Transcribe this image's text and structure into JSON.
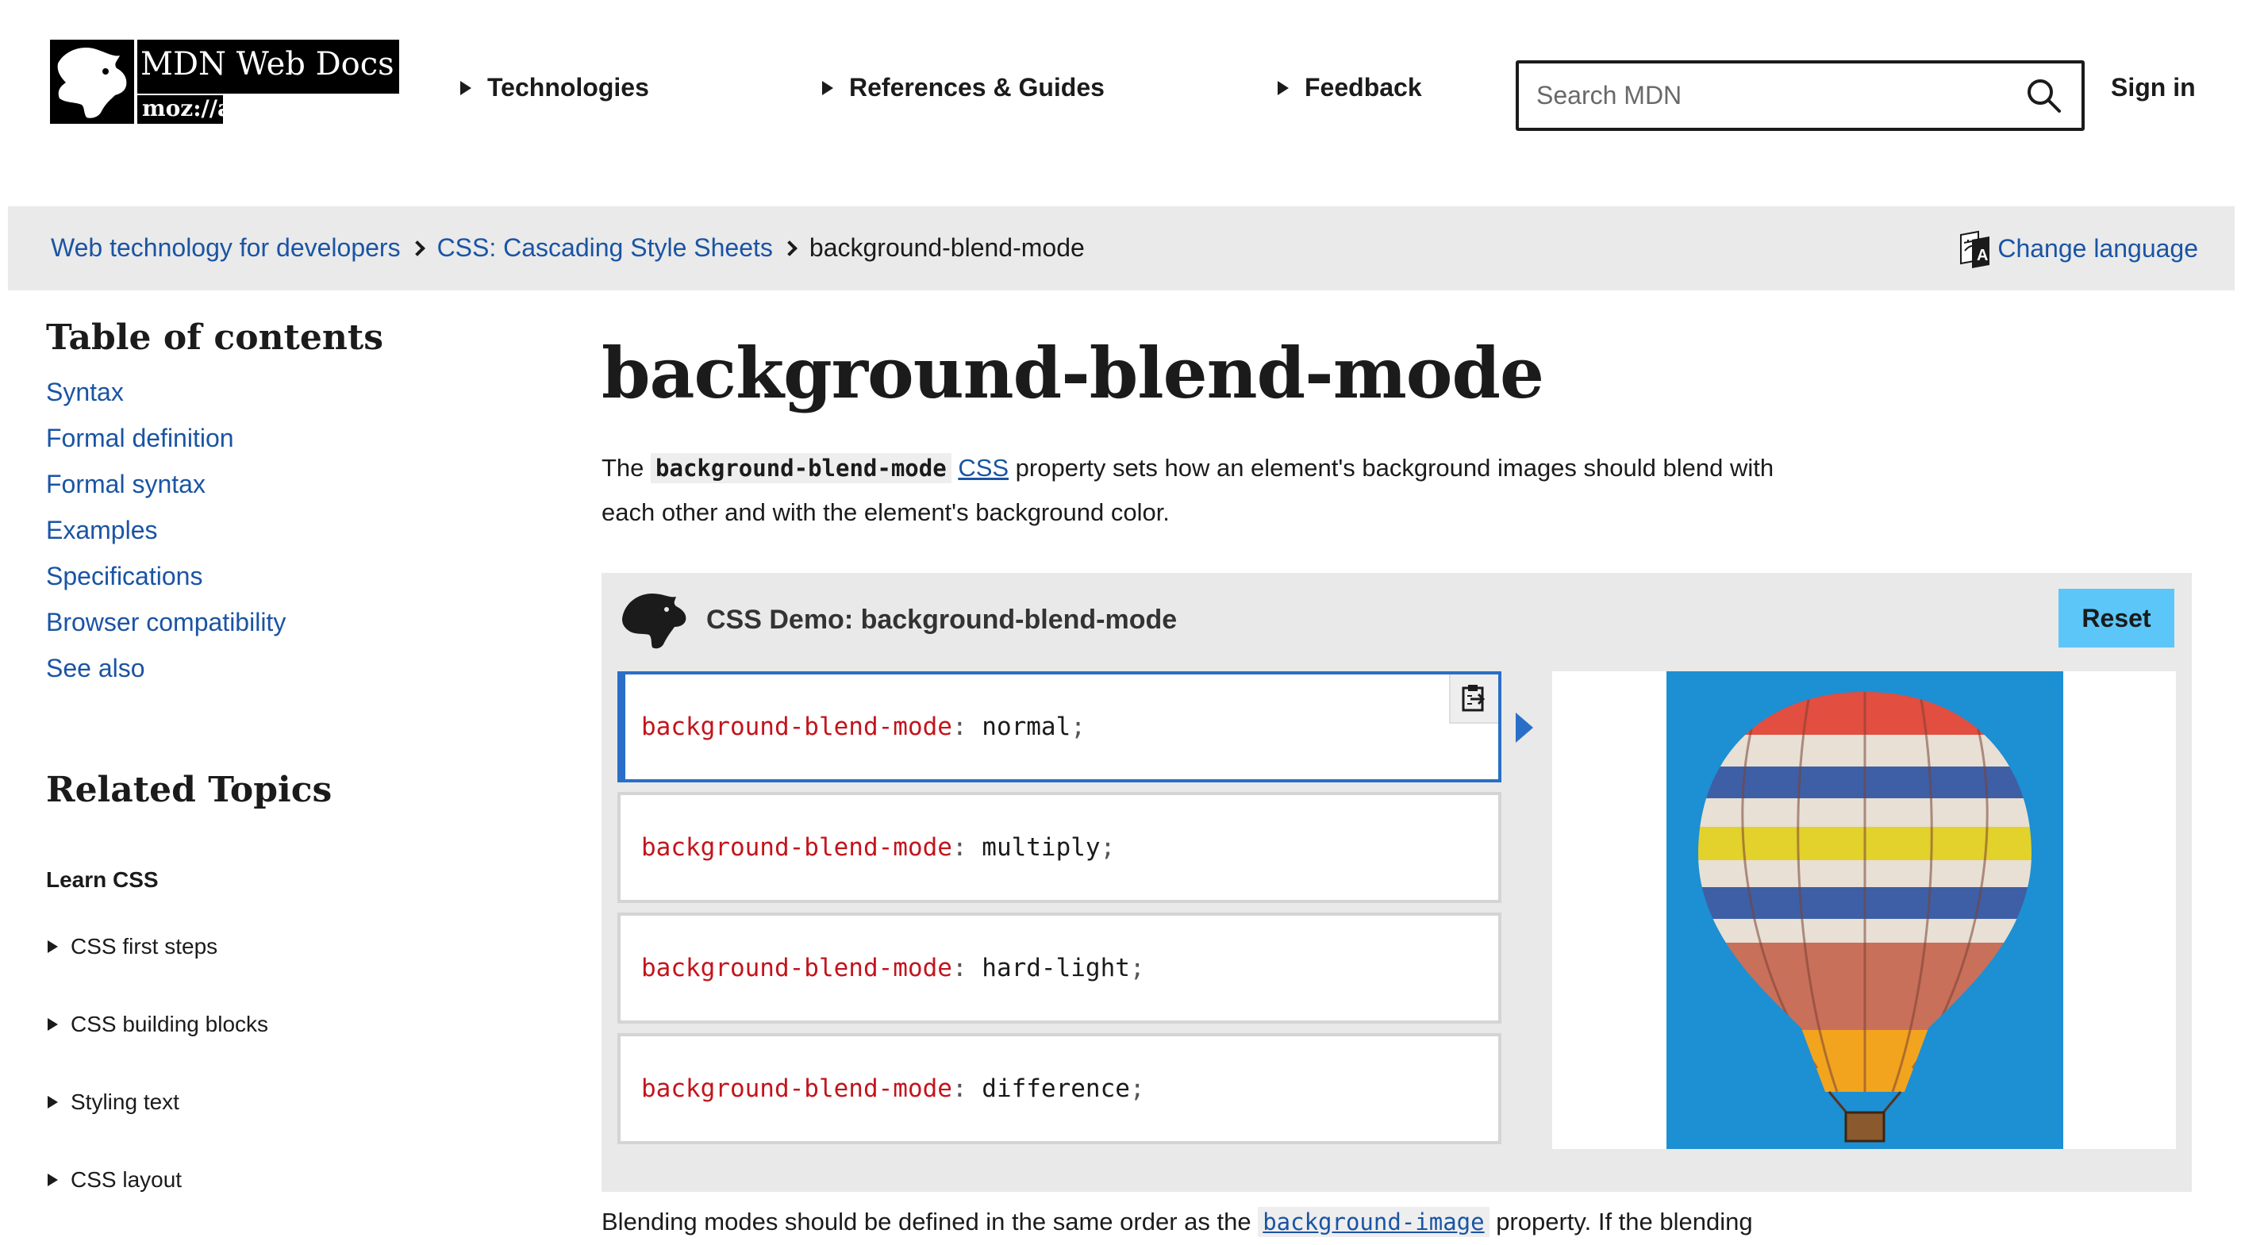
{
  "header": {
    "logo": {
      "title": "MDN Web Docs",
      "sub": "moz://a"
    },
    "nav": [
      "Technologies",
      "References & Guides",
      "Feedback"
    ],
    "search": {
      "placeholder": "Search MDN"
    },
    "signin": "Sign in"
  },
  "breadcrumb": {
    "items": [
      "Web technology for developers",
      "CSS: Cascading Style Sheets",
      "background-blend-mode"
    ],
    "change_language": "Change language"
  },
  "sidebar": {
    "toc_heading": "Table of contents",
    "toc": [
      "Syntax",
      "Formal definition",
      "Formal syntax",
      "Examples",
      "Specifications",
      "Browser compatibility",
      "See also"
    ],
    "related_heading": "Related Topics",
    "learn_heading": "Learn CSS",
    "topics": [
      "CSS first steps",
      "CSS building blocks",
      "Styling text",
      "CSS layout"
    ]
  },
  "main": {
    "title": "background-blend-mode",
    "intro_prefix": "The ",
    "intro_code": "background-blend-mode",
    "intro_link": "CSS",
    "intro_suffix": " property sets how an element's background images should blend with each other and with the element's background color.",
    "bottom_prefix": "Blending modes should be defined in the same order as the ",
    "bottom_code": "background-image",
    "bottom_suffix": " property. If the blending"
  },
  "demo": {
    "title": "CSS Demo: background-blend-mode",
    "reset": "Reset",
    "property": "background-blend-mode",
    "colon": ":",
    "semicolon": ";",
    "choices": [
      "normal",
      "multiply",
      "hard-light",
      "difference"
    ],
    "selected_index": 0
  },
  "colors": {
    "accent": "#2a6fc7",
    "reset_button": "#5cc6f9",
    "code_property": "#c3141c",
    "link": "#1a54a4"
  }
}
